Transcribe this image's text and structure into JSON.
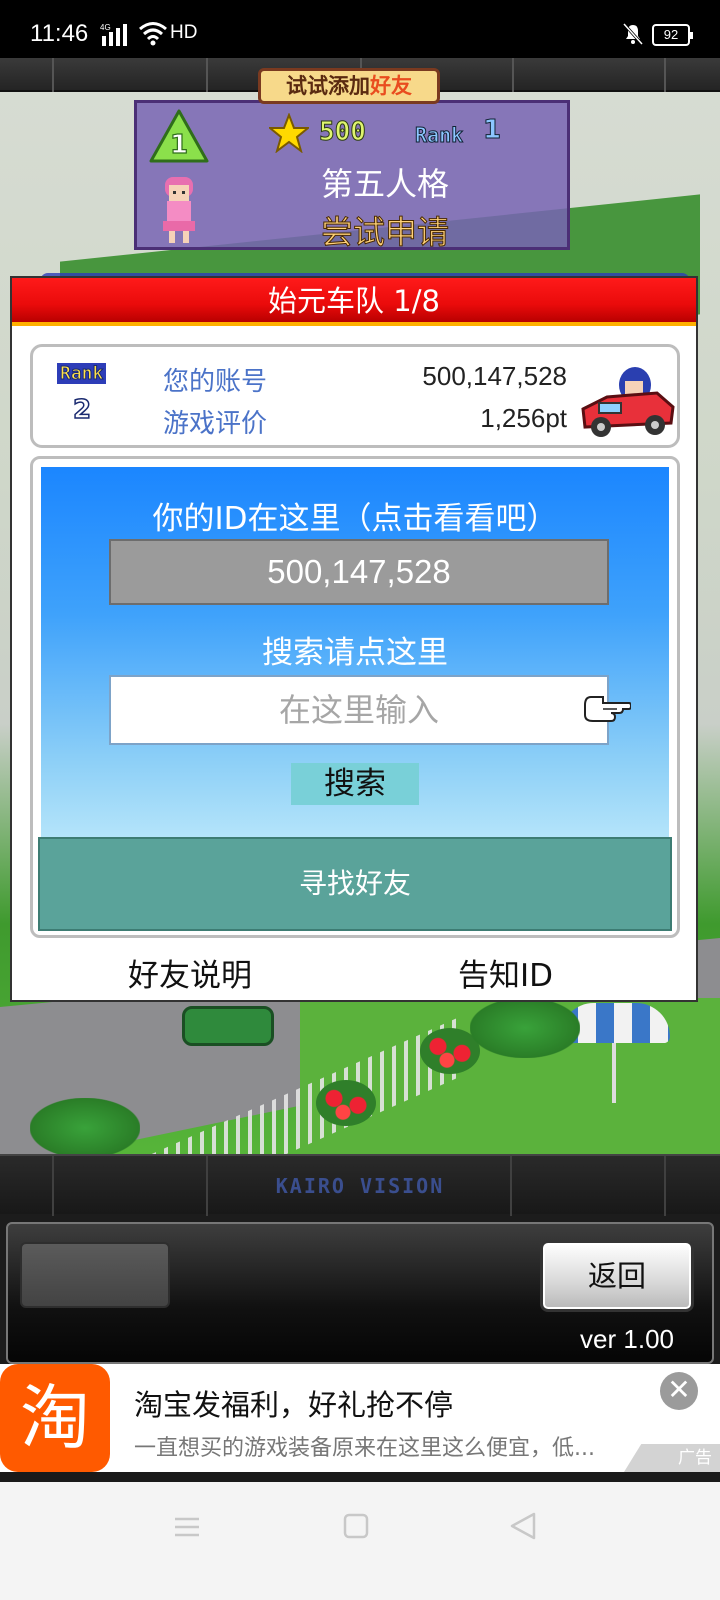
{
  "status_bar": {
    "time": "11:46",
    "network": "HD",
    "battery": "92"
  },
  "promo": {
    "tag_prefix": "试试添加",
    "tag_highlight": "好友",
    "level": "1",
    "points": "500",
    "rank_label": "Rank",
    "rank_value": "1",
    "name": "第五人格",
    "apply_label": "尝试申请"
  },
  "panel": {
    "title": "始元车队 1/8",
    "rank_label": "Rank",
    "rank_value": "2",
    "account_label": "您的账号",
    "account_value": "500,147,528",
    "rating_label": "游戏评价",
    "rating_value": "1,256pt",
    "id_caption": "你的ID在这里（点击看看吧）",
    "id_value": "500,147,528",
    "search_caption": "搜索请点这里",
    "search_placeholder": "在这里输入",
    "search_button": "搜索",
    "find_friends_button": "寻找好友",
    "friend_help_link": "好友说明",
    "share_id_link": "告知ID"
  },
  "bottom": {
    "publisher_logo": "KAIRO VISION",
    "back_button": "返回",
    "version": "ver 1.00"
  },
  "ad": {
    "logo_char": "淘",
    "title": "淘宝发福利，好礼抢不停",
    "description": "一直想买的游戏装备原来在这里这么便宜，低...",
    "tag": "广告",
    "close_symbol": "✕"
  },
  "colors": {
    "header_red": "#ea0b0b",
    "blue_area": "#1b86ff",
    "find_button": "#5aa39a",
    "account_label": "#4b73c8"
  }
}
